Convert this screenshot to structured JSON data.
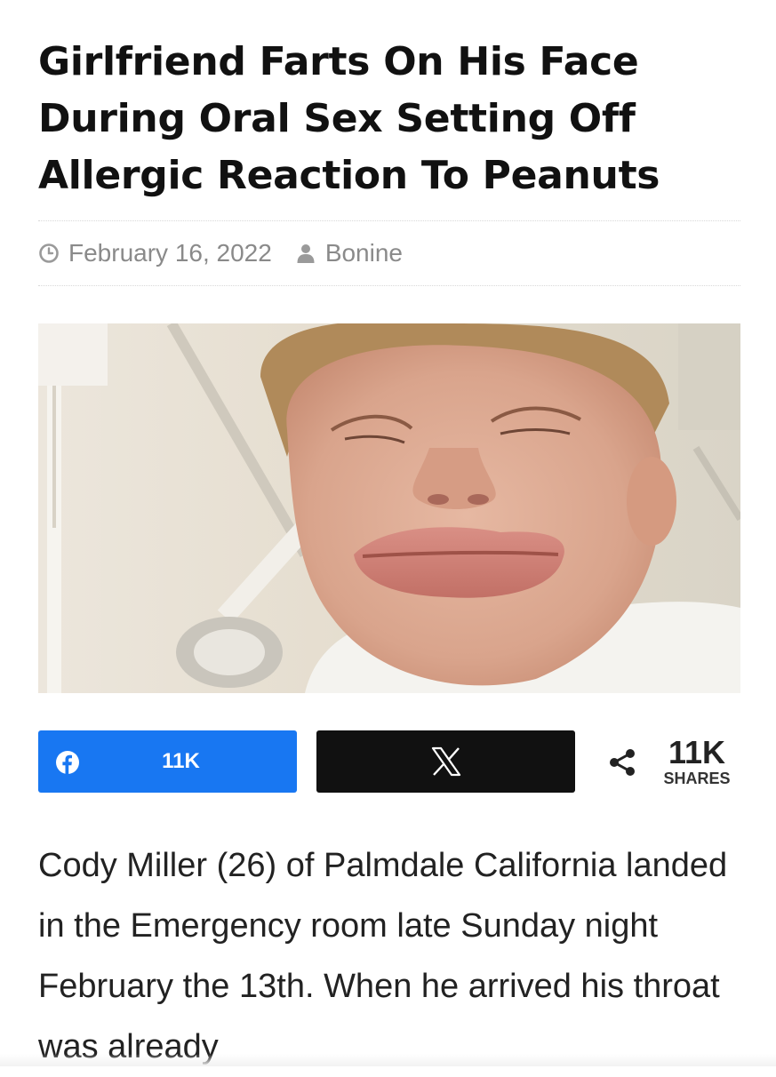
{
  "article": {
    "headline": "Girlfriend Farts On His Face During Oral Sex Setting Off Allergic Reaction To Peanuts",
    "date": "February 16, 2022",
    "author": "Bonine",
    "body": "Cody Miller (26) of Palmdale California landed in the Emergency room late Sunday night February the 13th. When he arrived his throat was already"
  },
  "share": {
    "facebook_count": "11K",
    "total_count": "11K",
    "total_label": "SHARES",
    "facebook_color": "#1877f2",
    "x_color": "#111111"
  },
  "icons": {
    "date": "clock-icon",
    "author": "user-icon",
    "facebook": "facebook-icon",
    "x": "x-logo-icon",
    "share": "share-icon"
  }
}
